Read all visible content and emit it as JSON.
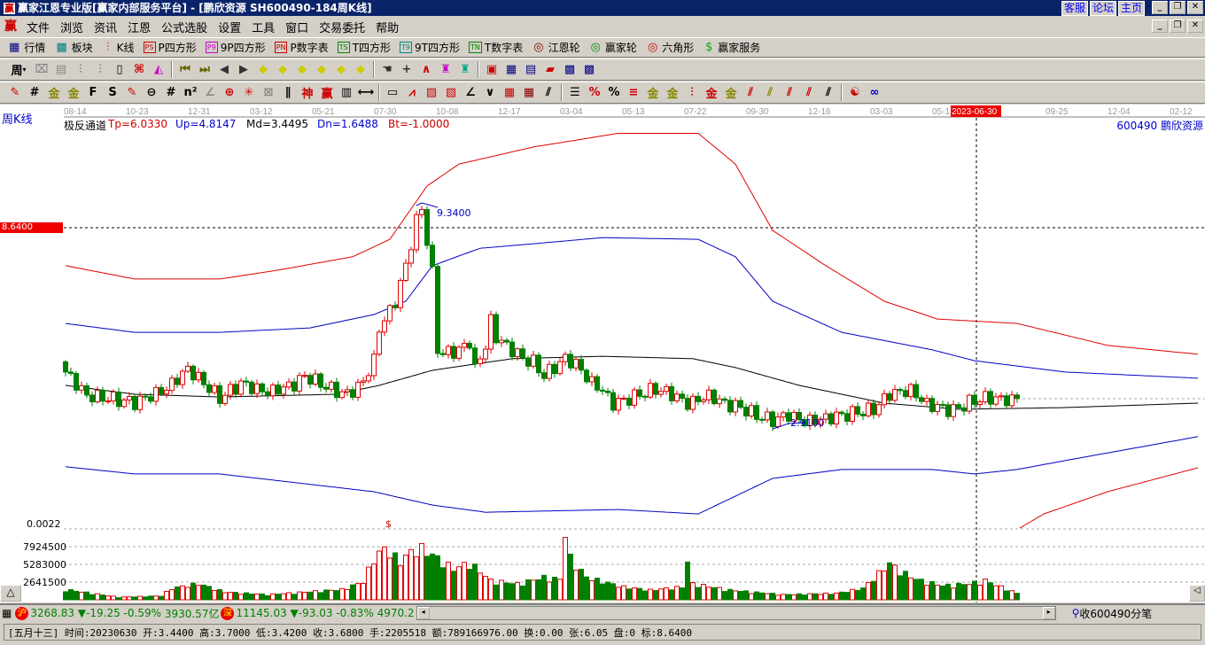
{
  "window": {
    "logo": "赢",
    "title": "赢家江恩专业版[赢家内部服务平台] - [鹏欣资源  SH600490-184周K线]",
    "links": [
      "客服",
      "论坛",
      "主页"
    ],
    "controls": [
      "_",
      "❐",
      "✕"
    ]
  },
  "menu": {
    "logo": "赢",
    "items": [
      "文件",
      "浏览",
      "资讯",
      "江恩",
      "公式选股",
      "设置",
      "工具",
      "窗口",
      "交易委托",
      "帮助"
    ]
  },
  "toolbar1": [
    {
      "icon": "▦",
      "label": "行情",
      "color": "#000080"
    },
    {
      "icon": "▩",
      "label": "板块",
      "color": "#008080"
    },
    {
      "icon": "⫶",
      "label": "K线",
      "color": "#c00"
    },
    {
      "icon": "PS",
      "label": "P四方形",
      "color": "#c00"
    },
    {
      "icon": "P9",
      "label": "9P四方形",
      "color": "#c0c"
    },
    {
      "icon": "PN",
      "label": "P数字表",
      "color": "#c00"
    },
    {
      "icon": "TS",
      "label": "T四方形",
      "color": "#080"
    },
    {
      "icon": "T9",
      "label": "9T四方形",
      "color": "#088"
    },
    {
      "icon": "TN",
      "label": "T数字表",
      "color": "#080"
    },
    {
      "icon": "◎",
      "label": "江恩轮",
      "color": "#800"
    },
    {
      "icon": "◎",
      "label": "赢家轮",
      "color": "#080"
    },
    {
      "icon": "◎",
      "label": "六角形",
      "color": "#c00"
    },
    {
      "icon": "$",
      "label": "赢家服务",
      "color": "#0a0"
    }
  ],
  "toolbar2": {
    "period": "周",
    "icons": [
      [
        "zoom-icon",
        "⌧",
        "#888"
      ],
      [
        "doc-icon",
        "▤",
        "#888"
      ],
      [
        "bars-icon",
        "⫶",
        "#888"
      ],
      [
        "bars2-icon",
        "⫶",
        "#888"
      ],
      [
        "candle-icon",
        "▯",
        "#000"
      ],
      [
        "pattern-icon",
        "⌘",
        "#c00"
      ],
      [
        "flag-icon",
        "◭",
        "#c0c"
      ],
      "|",
      [
        "first-icon",
        "⏮",
        "#660"
      ],
      [
        "last-icon",
        "⏭",
        "#660"
      ],
      [
        "left-icon",
        "◀",
        "#333"
      ],
      [
        "right-icon",
        "▶",
        "#333"
      ],
      [
        "left-diamond-icon",
        "◆",
        "#cc0"
      ],
      [
        "right-diamond-icon",
        "◆",
        "#cc0"
      ],
      [
        "h-diamond-icon",
        "◆",
        "#cc0"
      ],
      [
        "x-diamond-icon",
        "◆",
        "#cc0"
      ],
      [
        "s-diamond-icon",
        "◆",
        "#cc0"
      ],
      [
        "v-diamond-icon",
        "◆",
        "#cc0"
      ],
      "|",
      [
        "hand-icon",
        "☚",
        "#333"
      ],
      [
        "crosshair-icon",
        "+",
        "#333"
      ],
      [
        "line-tool-icon",
        "∧",
        "#c00"
      ],
      [
        "formula-icon",
        "♜",
        "#c0c"
      ],
      [
        "formula2-icon",
        "♜",
        "#0a8"
      ],
      "|",
      [
        "calendar-icon",
        "▣",
        "#c00"
      ],
      [
        "calculator-icon",
        "▦",
        "#008"
      ],
      [
        "notes-icon",
        "▤",
        "#008"
      ],
      [
        "save-icon",
        "▰",
        "#c00"
      ],
      [
        "network-icon",
        "▩",
        "#008"
      ],
      [
        "truck-icon",
        "▩",
        "#008"
      ]
    ]
  },
  "toolbar3": {
    "icons": [
      [
        "pen-icon",
        "✎",
        "#c00"
      ],
      [
        "grid-icon",
        "#",
        "#000"
      ],
      [
        "gold-grid-icon",
        "金",
        "#880"
      ],
      [
        "gold-grid2-icon",
        "金",
        "#880"
      ],
      [
        "fib-icon",
        "F",
        "#000"
      ],
      [
        "spiral-icon",
        "S",
        "#000"
      ],
      [
        "pen2-icon",
        "✎",
        "#c00"
      ],
      [
        "circle-icon",
        "⊖",
        "#000"
      ],
      [
        "hash-icon",
        "#",
        "#000"
      ],
      [
        "n2-icon",
        "n²",
        "#000"
      ],
      [
        "angle-icon",
        "∠",
        "#888"
      ],
      [
        "target-icon",
        "⊕",
        "#c00"
      ],
      [
        "star-icon",
        "✳",
        "#c00"
      ],
      [
        "box-icon",
        "⊠",
        "#888"
      ],
      [
        "lines-icon",
        "∥",
        "#000"
      ],
      [
        "shen-icon",
        "神",
        "#c00"
      ],
      [
        "win-icon",
        "赢",
        "#c00"
      ],
      [
        "ruler-icon",
        "▥",
        "#000"
      ],
      [
        "measure-icon",
        "⟷",
        "#000"
      ],
      "|",
      [
        "rect-icon",
        "▭",
        "#000"
      ],
      [
        "fan-icon",
        "⩘",
        "#c00"
      ],
      [
        "fanbox-icon",
        "▨",
        "#c00"
      ],
      [
        "fanbox2-icon",
        "▧",
        "#c00"
      ],
      [
        "angle2-icon",
        "∠",
        "#000"
      ],
      [
        "zigzag-icon",
        "∨",
        "#000"
      ],
      [
        "grid2-icon",
        "▦",
        "#c00"
      ],
      [
        "grid3-icon",
        "▦",
        "#800"
      ],
      [
        "parallel-icon",
        "⫽",
        "#000"
      ],
      "|",
      [
        "list-icon",
        "☰",
        "#000"
      ],
      [
        "percent-slash-icon",
        "%",
        "#c00"
      ],
      [
        "percent-icon",
        "%",
        "#000"
      ],
      [
        "equal-icon",
        "≡",
        "#c00"
      ],
      [
        "gold3-icon",
        "金",
        "#880"
      ],
      [
        "gold4-icon",
        "金",
        "#880"
      ],
      [
        "cycle-icon",
        "⫶",
        "#c00"
      ],
      [
        "gold5-icon",
        "金",
        "#c00"
      ],
      [
        "gold6-icon",
        "金",
        "#880"
      ],
      [
        "fib2-icon",
        "⫽",
        "#c00"
      ],
      [
        "fib3-icon",
        "⫽",
        "#880"
      ],
      [
        "arc-icon",
        "⫽",
        "#c00"
      ],
      [
        "arc2-icon",
        "⫽",
        "#c00"
      ],
      [
        "arc3-icon",
        "⫽",
        "#000"
      ],
      "|",
      [
        "yinyang-icon",
        "☯",
        "#c00"
      ],
      [
        "infinity-icon",
        "∞",
        "#00c"
      ]
    ]
  },
  "chart": {
    "period_label": "周K线",
    "indicator": "极反通道",
    "tp": "Tp=6.0330",
    "up": "Up=4.8147",
    "md": "Md=3.4495",
    "dn": "Dn=1.6488",
    "bt": "Bt=-1.0000",
    "symbol": "600490  鹏欣资源",
    "dates": [
      "08-14",
      "10-23",
      "12-31",
      "03-12",
      "05-21",
      "07-30",
      "10-08",
      "12-17",
      "03-04",
      "05-13",
      "07-22",
      "09-30",
      "12-16",
      "03-03",
      "05-12",
      "2023-06-30",
      "09-25",
      "12-04",
      "02-12"
    ],
    "cursor_price": "8.6400",
    "high_label": "9.3400",
    "low_label": "2.9100",
    "dollar_mark": "$",
    "vol_axis": [
      "0.0022",
      "7924500",
      "5283000",
      "2641500"
    ],
    "colors": {
      "up": "#e00000",
      "down": "#008000",
      "upper_band": "#0000c0",
      "outer_band": "#e00000",
      "mid": "#000000"
    },
    "close_keypoints": [
      [
        0,
        4.42
      ],
      [
        4,
        3.7
      ],
      [
        13,
        3.55
      ],
      [
        19,
        3.95
      ],
      [
        23,
        4.5
      ],
      [
        29,
        3.64
      ],
      [
        33,
        4.1
      ],
      [
        38,
        3.85
      ],
      [
        43,
        4.05
      ],
      [
        45,
        4.29
      ],
      [
        50,
        3.9
      ],
      [
        53,
        3.77
      ],
      [
        56,
        4.16
      ],
      [
        58,
        4.81
      ],
      [
        59,
        5.71
      ],
      [
        62,
        6.49
      ],
      [
        64,
        7.53
      ],
      [
        66,
        8.82
      ],
      [
        67,
        9.2
      ],
      [
        69,
        7.27
      ],
      [
        70,
        5.1
      ],
      [
        71,
        4.94
      ],
      [
        74,
        5.07
      ],
      [
        76,
        5.32
      ],
      [
        77,
        4.55
      ],
      [
        79,
        5.2
      ],
      [
        80,
        5.97
      ],
      [
        81,
        5.45
      ],
      [
        84,
        5.07
      ],
      [
        86,
        4.81
      ],
      [
        88,
        4.68
      ],
      [
        90,
        4.29
      ],
      [
        92,
        4.55
      ],
      [
        94,
        4.81
      ],
      [
        96,
        4.68
      ],
      [
        98,
        4.29
      ],
      [
        101,
        3.9
      ],
      [
        103,
        3.51
      ],
      [
        106,
        3.64
      ],
      [
        111,
        3.9
      ],
      [
        114,
        3.77
      ],
      [
        117,
        3.51
      ],
      [
        121,
        3.77
      ],
      [
        124,
        3.51
      ],
      [
        127,
        3.38
      ],
      [
        130,
        3.12
      ],
      [
        133,
        2.99
      ],
      [
        136,
        3.17
      ],
      [
        139,
        2.99
      ],
      [
        144,
        3.12
      ],
      [
        148,
        3.2
      ],
      [
        152,
        3.3
      ],
      [
        155,
        3.77
      ],
      [
        159,
        3.9
      ],
      [
        162,
        3.51
      ],
      [
        167,
        3.3
      ],
      [
        170,
        3.51
      ],
      [
        173,
        3.64
      ],
      [
        178,
        3.6
      ],
      [
        179,
        3.68
      ]
    ],
    "volume_keypoints_m": [
      [
        0,
        1.6
      ],
      [
        5,
        1.0
      ],
      [
        10,
        0.4
      ],
      [
        18,
        0.6
      ],
      [
        20,
        1.8
      ],
      [
        25,
        2.5
      ],
      [
        30,
        1.2
      ],
      [
        38,
        0.8
      ],
      [
        45,
        1.2
      ],
      [
        52,
        1.6
      ],
      [
        56,
        2.8
      ],
      [
        58,
        6.5
      ],
      [
        60,
        8.0
      ],
      [
        63,
        6.0
      ],
      [
        65,
        7.5
      ],
      [
        67,
        8.0
      ],
      [
        70,
        6.5
      ],
      [
        73,
        4.8
      ],
      [
        76,
        5.8
      ],
      [
        80,
        3.0
      ],
      [
        85,
        2.5
      ],
      [
        90,
        3.5
      ],
      [
        93,
        3.2
      ],
      [
        94,
        10.5
      ],
      [
        95,
        6.5
      ],
      [
        98,
        3.5
      ],
      [
        105,
        2.0
      ],
      [
        110,
        1.5
      ],
      [
        116,
        2.0
      ],
      [
        117,
        5.9
      ],
      [
        118,
        2.5
      ],
      [
        125,
        1.5
      ],
      [
        135,
        0.8
      ],
      [
        145,
        1.0
      ],
      [
        150,
        1.8
      ],
      [
        155,
        5.7
      ],
      [
        157,
        4.5
      ],
      [
        160,
        3.2
      ],
      [
        165,
        2.2
      ],
      [
        170,
        2.5
      ],
      [
        173,
        3.0
      ],
      [
        179,
        1.0
      ]
    ],
    "bands": {
      "top": [
        [
          0,
          7.53
        ],
        [
          13,
          7.14
        ],
        [
          29,
          7.14
        ],
        [
          40,
          7.4
        ],
        [
          54,
          7.79
        ],
        [
          61,
          8.3
        ],
        [
          68,
          9.86
        ],
        [
          74,
          10.5
        ],
        [
          88,
          11.0
        ],
        [
          104,
          11.4
        ],
        [
          119,
          11.4
        ],
        [
          126,
          10.5
        ],
        [
          133,
          8.56
        ],
        [
          143,
          7.53
        ],
        [
          154,
          6.49
        ],
        [
          164,
          5.97
        ],
        [
          179,
          5.84
        ],
        [
          196,
          5.2
        ],
        [
          213,
          4.94
        ]
      ],
      "up": [
        [
          0,
          5.84
        ],
        [
          13,
          5.58
        ],
        [
          29,
          5.58
        ],
        [
          46,
          5.71
        ],
        [
          58,
          6.1
        ],
        [
          64,
          6.49
        ],
        [
          69,
          7.53
        ],
        [
          78,
          8.04
        ],
        [
          88,
          8.17
        ],
        [
          101,
          8.35
        ],
        [
          119,
          8.3
        ],
        [
          126,
          7.79
        ],
        [
          133,
          6.49
        ],
        [
          146,
          5.58
        ],
        [
          163,
          5.07
        ],
        [
          171,
          4.75
        ],
        [
          188,
          4.42
        ],
        [
          213,
          4.24
        ]
      ],
      "mid": [
        [
          0,
          4.03
        ],
        [
          13,
          3.77
        ],
        [
          29,
          3.69
        ],
        [
          51,
          3.77
        ],
        [
          59,
          4.03
        ],
        [
          69,
          4.47
        ],
        [
          84,
          4.81
        ],
        [
          101,
          4.88
        ],
        [
          118,
          4.81
        ],
        [
          126,
          4.55
        ],
        [
          138,
          4.03
        ],
        [
          154,
          3.51
        ],
        [
          168,
          3.33
        ],
        [
          188,
          3.38
        ],
        [
          213,
          3.51
        ]
      ],
      "dn": [
        [
          0,
          1.65
        ],
        [
          13,
          1.44
        ],
        [
          29,
          1.44
        ],
        [
          58,
          0.92
        ],
        [
          69,
          0.53
        ],
        [
          79,
          0.32
        ],
        [
          104,
          0.4
        ],
        [
          119,
          0.27
        ],
        [
          126,
          0.79
        ],
        [
          133,
          1.31
        ],
        [
          146,
          1.57
        ],
        [
          163,
          1.57
        ],
        [
          171,
          1.44
        ],
        [
          179,
          1.57
        ],
        [
          188,
          1.83
        ],
        [
          213,
          2.53
        ]
      ],
      "bottom": [
        [
          179,
          -0.19
        ],
        [
          184,
          0.27
        ],
        [
          196,
          0.92
        ],
        [
          213,
          1.62
        ]
      ]
    }
  },
  "status1": {
    "sh_badge": "沪",
    "sh_index": "3268.83",
    "sh_change": "▼-19.25",
    "sh_pct": "-0.59%",
    "sh_amount": "3930.57亿",
    "sz_badge": "深",
    "sz_index": "11145.03",
    "sz_change": "▼-93.03",
    "sz_pct": "-0.83%",
    "sz_amount": "4970.2",
    "receive": "收600490分笔"
  },
  "status2": {
    "text": "[五月十三] 时间:20230630 开:3.4400 高:3.7000 低:3.4200 收:3.6800 手:2205518 额:789166976.00 换:0.00 张:6.05 盘:0 标:8.6400"
  }
}
